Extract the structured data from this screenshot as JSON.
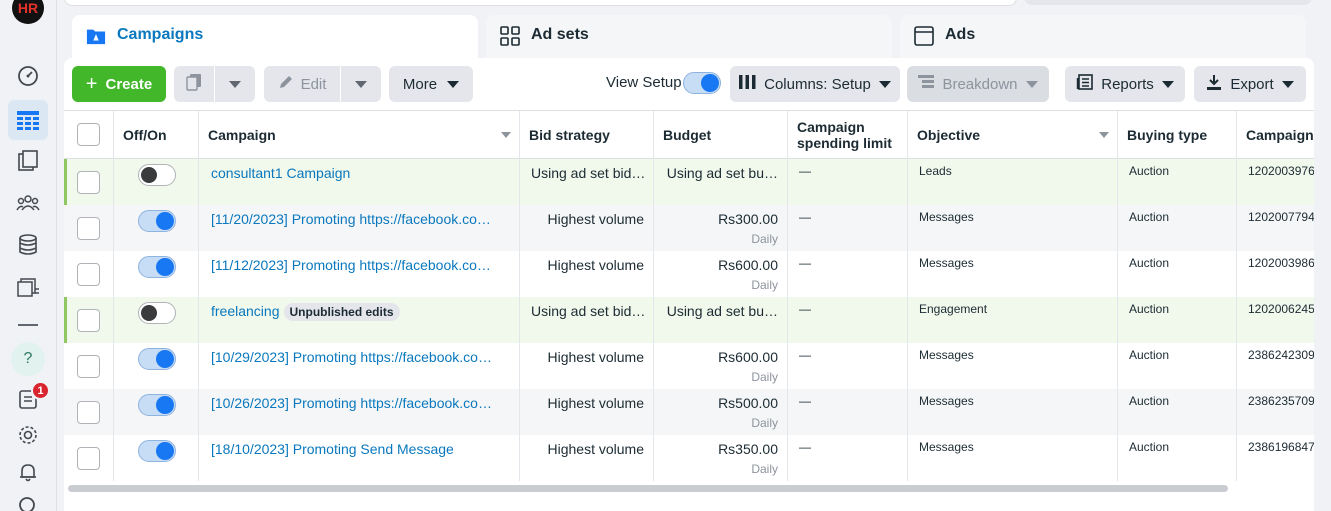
{
  "rail": {
    "logo_text": "HR",
    "notification_count": "1",
    "help_glyph": "?"
  },
  "tabs": [
    {
      "label": "Campaigns",
      "active": true
    },
    {
      "label": "Ad sets",
      "active": false
    },
    {
      "label": "Ads",
      "active": false
    }
  ],
  "toolbar": {
    "create_label": "Create",
    "edit_label": "Edit",
    "more_label": "More",
    "view_setup_label": "View Setup",
    "columns_label": "Columns: Setup",
    "breakdown_label": "Breakdown",
    "reports_label": "Reports",
    "export_label": "Export"
  },
  "table": {
    "headers": {
      "off_on": "Off/On",
      "campaign": "Campaign",
      "bid_strategy": "Bid strategy",
      "budget": "Budget",
      "spending_limit_1": "Campaign",
      "spending_limit_2": "spending limit",
      "objective": "Objective",
      "buying_type": "Buying type",
      "campaign_id": "Campaign"
    },
    "rows": [
      {
        "name": "consultant1 Campaign",
        "badge": "",
        "on": false,
        "bid": "Using ad set bid…",
        "budget": "Using ad set bu…",
        "daily": "",
        "limit": "—",
        "objective": "Leads",
        "buying": "Auction",
        "id": "1202003976"
      },
      {
        "name": "[11/20/2023] Promoting https://facebook.co…",
        "badge": "",
        "on": true,
        "bid": "Highest volume",
        "budget": "Rs300.00",
        "daily": "Daily",
        "limit": "—",
        "objective": "Messages",
        "buying": "Auction",
        "id": "1202007794"
      },
      {
        "name": "[11/12/2023] Promoting https://facebook.co…",
        "badge": "",
        "on": true,
        "bid": "Highest volume",
        "budget": "Rs600.00",
        "daily": "Daily",
        "limit": "—",
        "objective": "Messages",
        "buying": "Auction",
        "id": "1202003986"
      },
      {
        "name": "freelancing",
        "badge": "Unpublished edits",
        "on": false,
        "bid": "Using ad set bid…",
        "budget": "Using ad set bu…",
        "daily": "",
        "limit": "—",
        "objective": "Engagement",
        "buying": "Auction",
        "id": "1202006245"
      },
      {
        "name": "[10/29/2023] Promoting https://facebook.co…",
        "badge": "",
        "on": true,
        "bid": "Highest volume",
        "budget": "Rs600.00",
        "daily": "Daily",
        "limit": "—",
        "objective": "Messages",
        "buying": "Auction",
        "id": "2386242309"
      },
      {
        "name": "[10/26/2023] Promoting https://facebook.co…",
        "badge": "",
        "on": true,
        "bid": "Highest volume",
        "budget": "Rs500.00",
        "daily": "Daily",
        "limit": "—",
        "objective": "Messages",
        "buying": "Auction",
        "id": "2386235709"
      },
      {
        "name": "[18/10/2023] Promoting Send Message",
        "badge": "",
        "on": true,
        "bid": "Highest volume",
        "budget": "Rs350.00",
        "daily": "Daily",
        "limit": "—",
        "objective": "Messages",
        "buying": "Auction",
        "id": "2386196847"
      }
    ]
  },
  "colors": {
    "accent": "#1877f2",
    "create_green": "#42b72a",
    "link_blue": "#0a78be",
    "highlight_row": "#f1f8ec",
    "badge_red": "#d9232d"
  }
}
